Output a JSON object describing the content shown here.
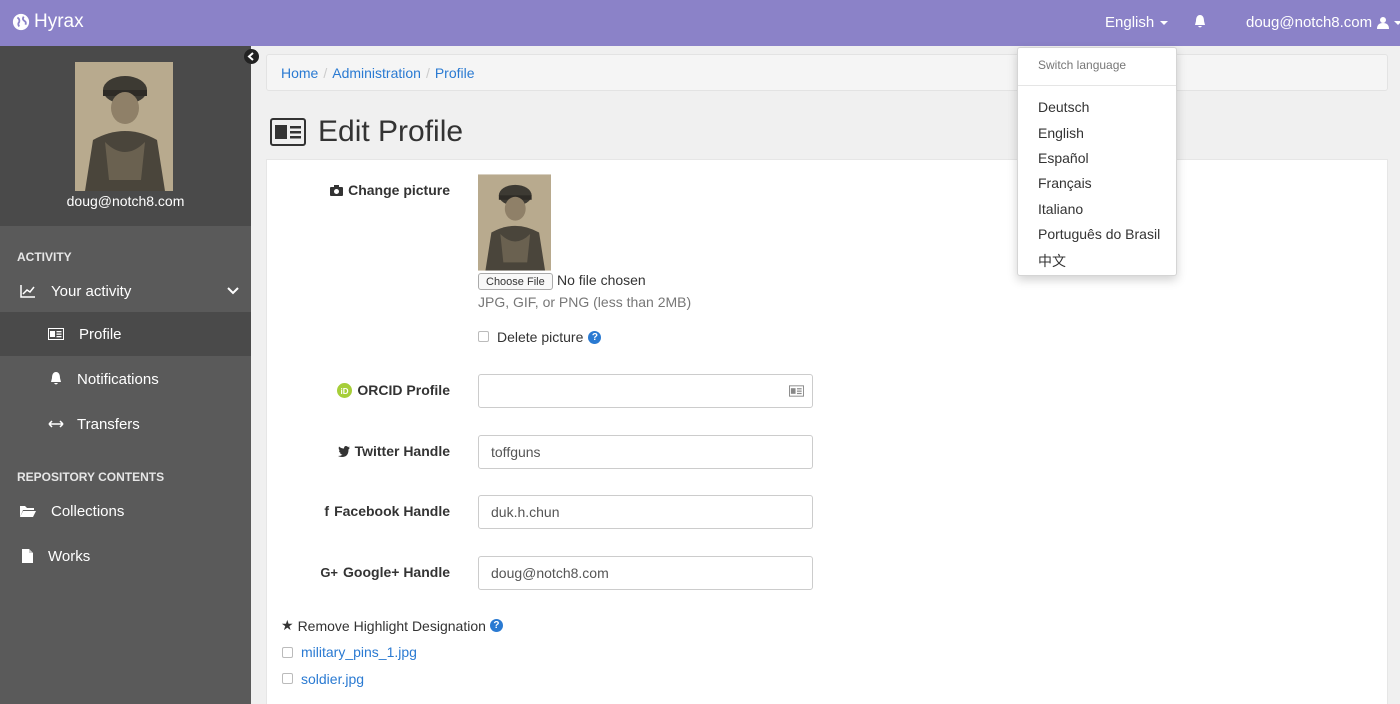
{
  "app": {
    "brand": "Hyrax"
  },
  "navbar": {
    "language": "English",
    "user": "doug@notch8.com"
  },
  "language_menu": {
    "header": "Switch language",
    "items": [
      "Deutsch",
      "English",
      "Español",
      "Français",
      "Italiano",
      "Português do Brasil",
      "中文"
    ]
  },
  "sidebar": {
    "email": "doug@notch8.com",
    "activity_heading": "ACTIVITY",
    "your_activity": "Your activity",
    "profile": "Profile",
    "notifications": "Notifications",
    "transfers": "Transfers",
    "repo_heading": "REPOSITORY CONTENTS",
    "collections": "Collections",
    "works": "Works"
  },
  "breadcrumb": [
    "Home",
    "Administration",
    "Profile"
  ],
  "page": {
    "title": "Edit Profile"
  },
  "form": {
    "change_picture_label": "Change picture",
    "choose_file": "Choose File",
    "no_file": "No file chosen",
    "file_hint": "JPG, GIF, or PNG (less than 2MB)",
    "delete_picture": "Delete picture",
    "orcid_label": "ORCID Profile",
    "orcid_value": "",
    "twitter_label": "Twitter Handle",
    "twitter_value": "toffguns",
    "facebook_label": "Facebook Handle",
    "facebook_value": "duk.h.chun",
    "google_label": "Google+ Handle",
    "google_value": "doug@notch8.com",
    "highlight_label": "Remove Highlight Designation",
    "highlights": [
      "military_pins_1.jpg",
      "soldier.jpg"
    ]
  },
  "colors": {
    "navbar": "#8b82c8",
    "sidebar": "#5a5a5a",
    "link": "#2a7ad2"
  }
}
